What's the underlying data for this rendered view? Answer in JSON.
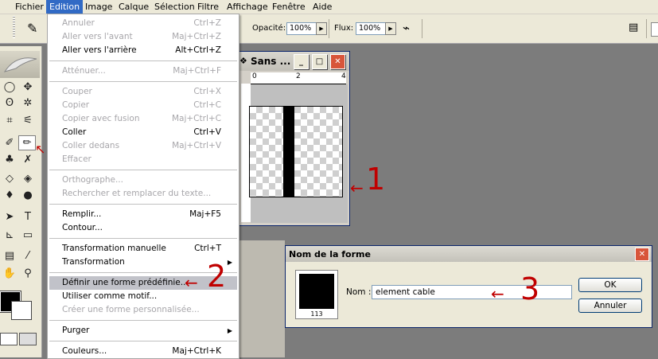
{
  "menubar": {
    "items": [
      "Fichier",
      "Edition",
      "Image",
      "Calque",
      "Sélection",
      "Filtre",
      "Affichage",
      "Fenêtre",
      "Aide"
    ],
    "active_index": 1
  },
  "options": {
    "opacity_label": "Opacité:",
    "opacity_value": "100%",
    "flux_label": "Flux:",
    "flux_value": "100%"
  },
  "document": {
    "title": "Sans ...",
    "ruler_marks": [
      "0",
      "2",
      "4"
    ]
  },
  "edit_menu": {
    "items": [
      {
        "label": "Annuler",
        "shortcut": "Ctrl+Z",
        "disabled": true
      },
      {
        "label": "Aller vers l'avant",
        "shortcut": "Maj+Ctrl+Z",
        "disabled": true
      },
      {
        "label": "Aller vers l'arrière",
        "shortcut": "Alt+Ctrl+Z",
        "disabled": false
      },
      {
        "label": "Atténuer...",
        "shortcut": "Maj+Ctrl+F",
        "disabled": true
      },
      {
        "label": "Couper",
        "shortcut": "Ctrl+X",
        "disabled": true
      },
      {
        "label": "Copier",
        "shortcut": "Ctrl+C",
        "disabled": true
      },
      {
        "label": "Copier avec fusion",
        "shortcut": "Maj+Ctrl+C",
        "disabled": true
      },
      {
        "label": "Coller",
        "shortcut": "Ctrl+V",
        "disabled": false
      },
      {
        "label": "Coller dedans",
        "shortcut": "Maj+Ctrl+V",
        "disabled": true
      },
      {
        "label": "Effacer",
        "shortcut": "",
        "disabled": true
      },
      {
        "label": "Orthographe...",
        "shortcut": "",
        "disabled": true
      },
      {
        "label": "Rechercher et remplacer du texte...",
        "shortcut": "",
        "disabled": true
      },
      {
        "label": "Remplir...",
        "shortcut": "Maj+F5",
        "disabled": false
      },
      {
        "label": "Contour...",
        "shortcut": "",
        "disabled": false
      },
      {
        "label": "Transformation manuelle",
        "shortcut": "Ctrl+T",
        "disabled": false
      },
      {
        "label": "Transformation",
        "shortcut": "",
        "disabled": false
      },
      {
        "label": "Définir une forme prédéfinie...",
        "shortcut": "",
        "disabled": false
      },
      {
        "label": "Utiliser comme motif...",
        "shortcut": "",
        "disabled": false
      },
      {
        "label": "Créer une forme personnalisée...",
        "shortcut": "",
        "disabled": true
      },
      {
        "label": "Purger",
        "shortcut": "",
        "disabled": false
      },
      {
        "label": "Couleurs...",
        "shortcut": "Maj+Ctrl+K",
        "disabled": false
      }
    ]
  },
  "dialog": {
    "title": "Nom de la forme",
    "thumb_number": "113",
    "name_label": "Nom :",
    "name_value": "element cable",
    "ok_label": "OK",
    "cancel_label": "Annuler"
  },
  "annotations": {
    "n1": "1",
    "n2": "2",
    "n3": "3",
    "arrow": "←"
  },
  "colors": {
    "annotation": "#c00000",
    "menu_highlight": "#c1c2c9",
    "menubar_active": "#316ac5"
  }
}
